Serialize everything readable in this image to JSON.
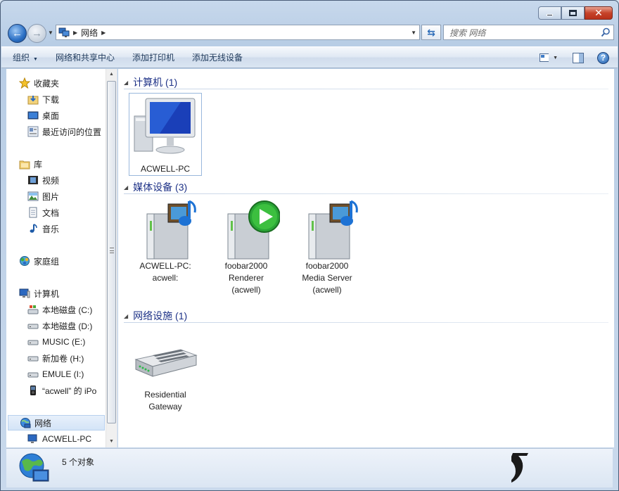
{
  "window": {
    "caption_buttons": [
      "minimize-icon",
      "maximize-icon",
      "close-icon"
    ]
  },
  "address": {
    "crumbs": [
      "网络"
    ],
    "search_placeholder": "搜索 网络"
  },
  "toolbar": {
    "organize": "组织",
    "network_center": "网络和共享中心",
    "add_printer": "添加打印机",
    "add_wireless": "添加无线设备"
  },
  "nav": {
    "favorites": "收藏夹",
    "downloads": "下载",
    "desktop": "桌面",
    "recent": "最近访问的位置",
    "libraries": "库",
    "videos": "视频",
    "pictures": "图片",
    "documents": "文档",
    "music": "音乐",
    "homegroup": "家庭组",
    "computer": "计算机",
    "drive_c": "本地磁盘 (C:)",
    "drive_d": "本地磁盘 (D:)",
    "drive_e": "MUSIC (E:)",
    "drive_h": "新加卷 (H:)",
    "drive_i": "EMULE (I:)",
    "ipod": "“acwell” 的 iPo",
    "network": "网络",
    "acwell_pc": "ACWELL-PC"
  },
  "groups": [
    {
      "title": "计算机 (1)",
      "items": [
        {
          "lines": [
            "ACWELL-PC"
          ]
        }
      ]
    },
    {
      "title": "媒体设备 (3)",
      "items": [
        {
          "lines": [
            "ACWELL-PC:",
            "acwell:"
          ]
        },
        {
          "lines": [
            "foobar2000",
            "Renderer",
            "(acwell)"
          ]
        },
        {
          "lines": [
            "foobar2000",
            "Media Server",
            "(acwell)"
          ]
        }
      ]
    },
    {
      "title": "网络设施 (1)",
      "items": [
        {
          "lines": [
            "Residential",
            "Gateway"
          ]
        }
      ]
    }
  ],
  "status": {
    "count": "5 个对象"
  },
  "colors": {
    "group_title": "#1e3287",
    "selection": "#d4e4f7"
  }
}
